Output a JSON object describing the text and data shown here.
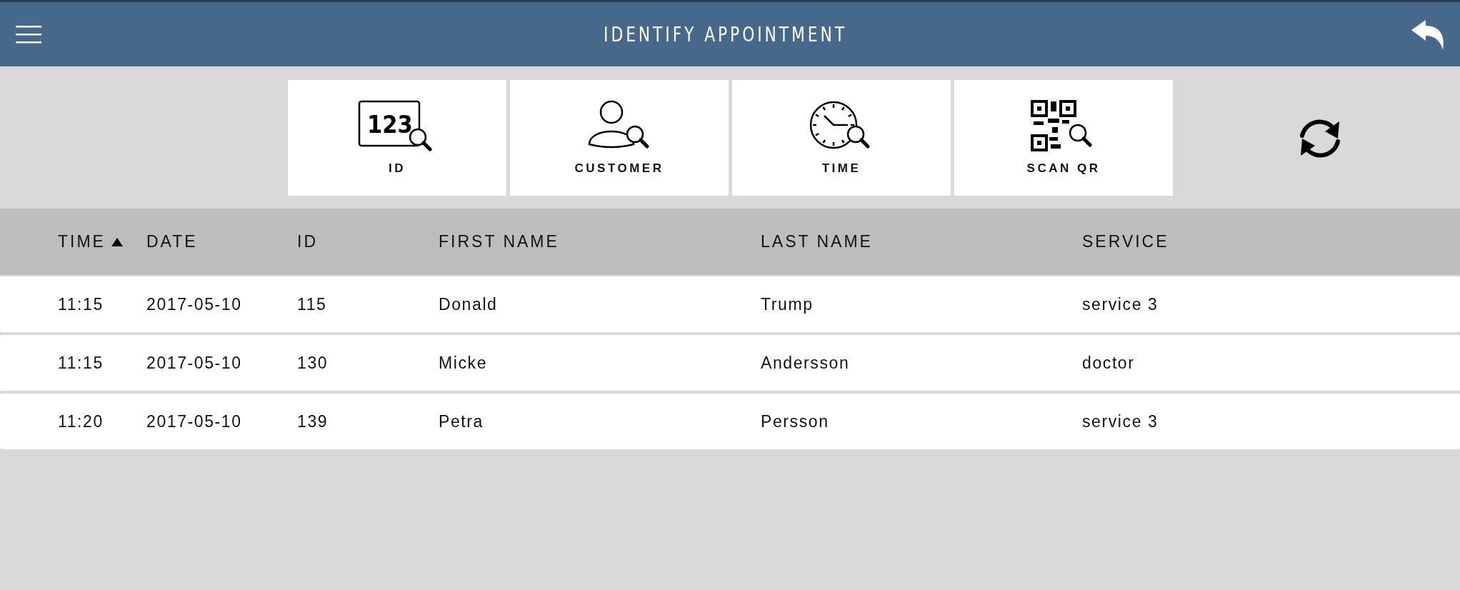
{
  "header": {
    "title": "IDENTIFY APPOINTMENT"
  },
  "search_tiles": [
    {
      "kind": "id",
      "icon_text": "123",
      "label": "ID"
    },
    {
      "kind": "customer",
      "label": "CUSTOMER"
    },
    {
      "kind": "time",
      "label": "TIME"
    },
    {
      "kind": "qr",
      "label": "SCAN QR"
    }
  ],
  "table": {
    "columns": [
      {
        "label": "TIME",
        "sorted": true
      },
      {
        "label": "DATE",
        "sorted": false
      },
      {
        "label": "ID",
        "sorted": false
      },
      {
        "label": "FIRST NAME",
        "sorted": false
      },
      {
        "label": "LAST NAME",
        "sorted": false
      },
      {
        "label": "SERVICE",
        "sorted": false
      }
    ],
    "rows": [
      [
        "11:15",
        "2017-05-10",
        "115",
        "Donald",
        "Trump",
        "service 3"
      ],
      [
        "11:15",
        "2017-05-10",
        "130",
        "Micke",
        "Andersson",
        "doctor"
      ],
      [
        "11:20",
        "2017-05-10",
        "139",
        "Petra",
        "Persson",
        "service 3"
      ]
    ]
  }
}
